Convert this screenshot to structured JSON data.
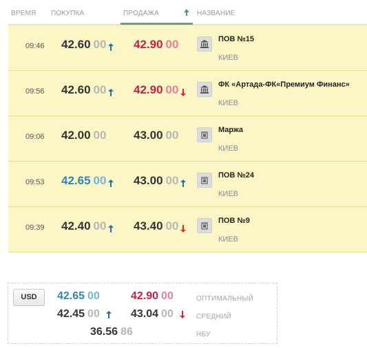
{
  "header": {
    "time": "ВРЕМЯ",
    "buy": "ПОКУПКА",
    "sell": "ПРОДАЖА",
    "name": "НАЗВАНИЕ",
    "sort_icon": "arrow-up-icon"
  },
  "rows": [
    {
      "time": "09:46",
      "buy_int": "42.60",
      "buy_frac": "00",
      "buy_trend": "up",
      "sell_int": "42.90",
      "sell_frac": "00",
      "sell_trend": "none",
      "name": "ПОВ №15",
      "city": "КИЕВ",
      "icon": "bank-icon"
    },
    {
      "time": "09:56",
      "buy_int": "42.60",
      "buy_frac": "00",
      "buy_trend": "up",
      "sell_int": "42.90",
      "sell_frac": "00",
      "sell_trend": "down",
      "name": "ФК «Артада-ФК«Премиум Финанс»",
      "city": "КИЕВ",
      "icon": "bank-icon"
    },
    {
      "time": "09:06",
      "buy_int": "42.00",
      "buy_frac": "00",
      "buy_trend": "none",
      "sell_int": "43.00",
      "sell_frac": "00",
      "sell_trend": "none",
      "name": "Маржа",
      "city": "КИЕВ",
      "icon": "exchange-office-icon"
    },
    {
      "time": "09:53",
      "buy_int": "42.65",
      "buy_frac": "00",
      "buy_trend": "up",
      "sell_int": "43.00",
      "sell_frac": "00",
      "sell_trend": "up",
      "name": "ПОВ №24",
      "city": "КИЕВ",
      "icon": "exchange-office-icon"
    },
    {
      "time": "09:39",
      "buy_int": "42.40",
      "buy_frac": "00",
      "buy_trend": "up",
      "sell_int": "43.40",
      "sell_frac": "00",
      "sell_trend": "down",
      "name": "ПОВ №9",
      "city": "КИЕВ",
      "icon": "exchange-office-icon"
    }
  ],
  "summary": {
    "currency": "USD",
    "optimal": {
      "buy_int": "42.65",
      "buy_frac": "00",
      "sell_int": "42.90",
      "sell_frac": "00",
      "label": "ОПТИМАЛЬНЫЙ"
    },
    "average": {
      "buy_int": "42.45",
      "buy_frac": "00",
      "buy_trend": "up",
      "sell_int": "43.04",
      "sell_frac": "00",
      "sell_trend": "down",
      "label": "СРЕДНИЙ"
    },
    "nbu": {
      "int": "36.56",
      "frac": "86",
      "label": "НБУ"
    }
  },
  "colors": {
    "row_bg": "#fcf5c6",
    "sell_red": "#c81e45",
    "best_blue": "#2f86b6",
    "arrow_up_blue": "#2b6d9a",
    "arrow_down_red": "#d6272e",
    "accent_green": "#5ba597"
  }
}
